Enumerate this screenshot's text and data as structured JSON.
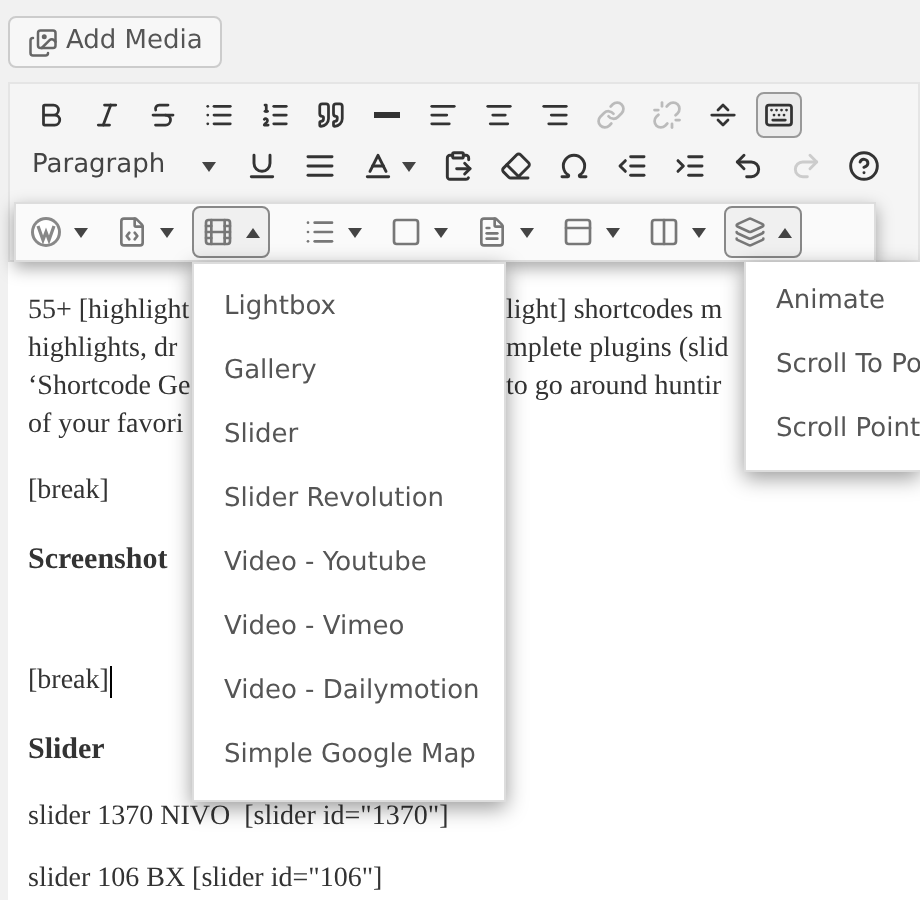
{
  "add_media": {
    "label": "Add Media"
  },
  "toolbar_row_1": [
    {
      "disabled": false,
      "pressed": false
    },
    {
      "disabled": false,
      "pressed": false
    },
    {
      "disabled": false,
      "pressed": false
    },
    {
      "disabled": false,
      "pressed": false
    },
    {
      "disabled": false,
      "pressed": false
    },
    {
      "disabled": false,
      "pressed": false
    },
    {
      "disabled": false,
      "pressed": false
    },
    {
      "disabled": false,
      "pressed": false
    },
    {
      "disabled": false,
      "pressed": false
    },
    {
      "disabled": false,
      "pressed": false
    },
    {
      "disabled": true,
      "pressed": false
    },
    {
      "disabled": true,
      "pressed": false
    },
    {
      "disabled": false,
      "pressed": false
    },
    {
      "disabled": false,
      "pressed": true
    }
  ],
  "format_select": {
    "value": "Paragraph"
  },
  "toolbar_row_2": [
    {
      "disabled": false
    },
    {
      "disabled": false
    },
    {
      "disabled": false
    },
    {
      "disabled": false
    },
    {
      "disabled": false
    },
    {
      "disabled": false
    },
    {
      "disabled": false
    },
    {
      "disabled": false
    },
    {
      "disabled": false
    },
    {
      "disabled": true
    },
    {
      "disabled": false
    }
  ],
  "shortcode_toolbar": [
    {
      "expanded": false
    },
    {
      "expanded": false
    },
    {
      "expanded": true
    },
    {
      "expanded": false
    },
    {
      "expanded": false
    },
    {
      "expanded": false
    },
    {
      "expanded": false
    },
    {
      "expanded": false
    },
    {
      "expanded": true
    }
  ],
  "content": [
    {
      "kind": "paragraph",
      "cursor": false,
      "lines": [
        {
          "left": "55+ [highlight",
          "right": "light] shortcodes m"
        },
        {
          "left": "highlights, dr",
          "right": "mplete plugins (slid"
        },
        {
          "left": "‘Shortcode Ge",
          "right": "to go around huntir"
        },
        {
          "left": "of your favori"
        }
      ]
    },
    {
      "kind": "shortcode",
      "cursor": false,
      "text": "[break]"
    },
    {
      "kind": "heading",
      "cursor": false,
      "text": "Screenshot"
    },
    {
      "kind": "spacer",
      "cursor": false
    },
    {
      "kind": "shortcode",
      "cursor": true,
      "text": "[break]"
    },
    {
      "kind": "heading",
      "cursor": false,
      "text": "Slider"
    },
    {
      "kind": "text",
      "cursor": false,
      "text": "slider 1370 NIVO  [slider id=\"1370\"]"
    },
    {
      "kind": "text",
      "cursor": false,
      "text": "slider 106 BX [slider id=\"106\"]"
    }
  ],
  "media_menu": {
    "items": [
      "Lightbox",
      "Gallery",
      "Slider",
      "Slider Revolution",
      "Video - Youtube",
      "Video - Vimeo",
      "Video - Dailymotion",
      "Simple Google Map"
    ]
  },
  "effects_menu": {
    "items": [
      "Animate",
      "Scroll To Po",
      "Scroll Point"
    ]
  }
}
